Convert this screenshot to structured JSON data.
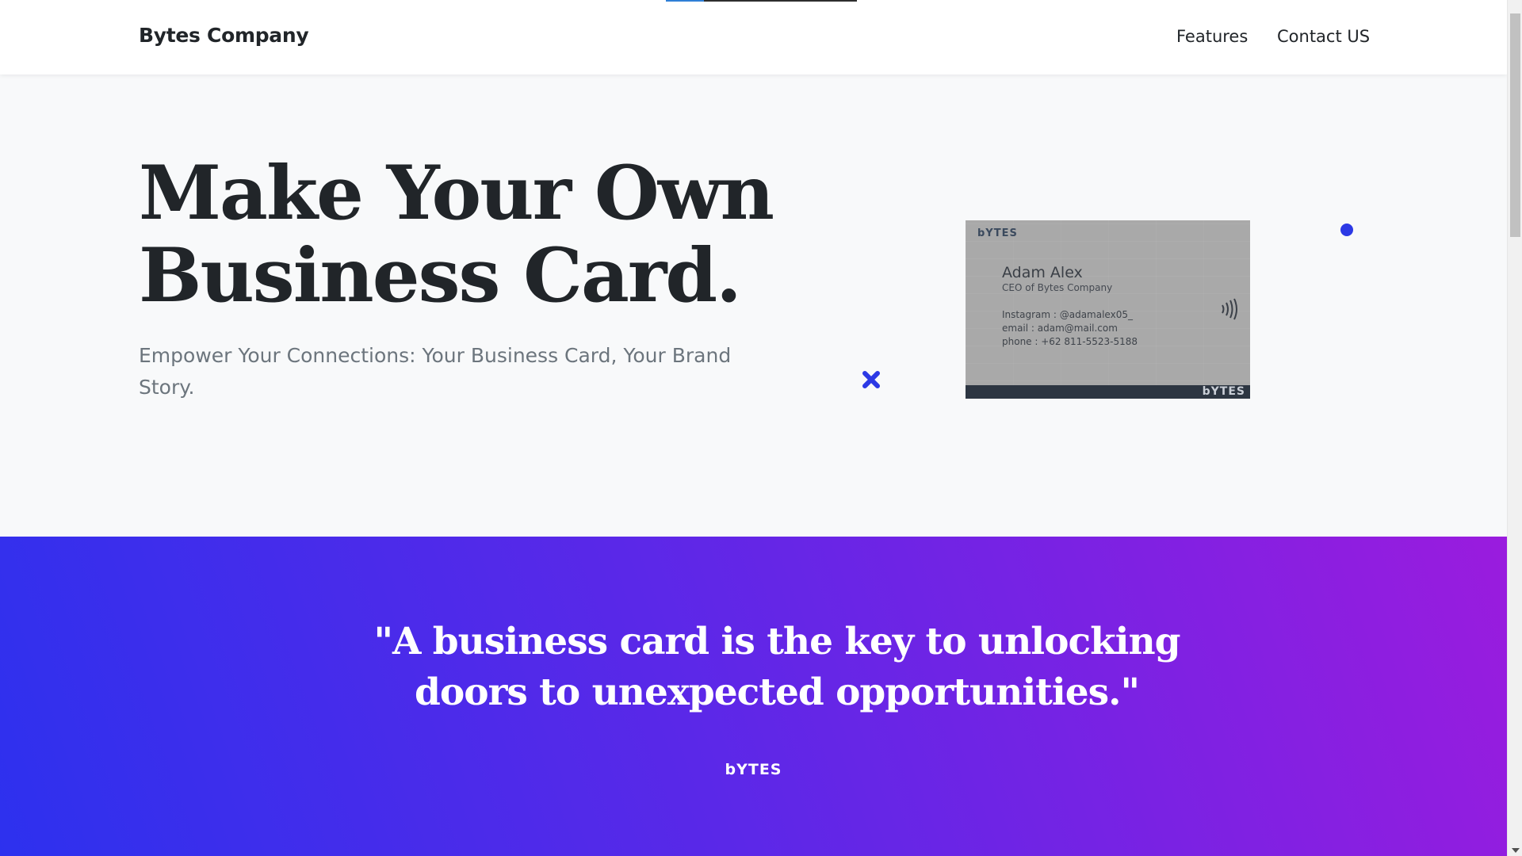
{
  "page_loader": {
    "progress": 0.2
  },
  "navbar": {
    "brand": "Bytes Company",
    "links": [
      {
        "label": "Features"
      },
      {
        "label": "Contact US"
      }
    ]
  },
  "hero": {
    "title_line1": "Make Your Own",
    "title_line2": "Business Card.",
    "subtitle": "Empower Your Connections: Your Business Card, Your Brand Story."
  },
  "card": {
    "logo_top": "bYTES",
    "name": "Adam Alex",
    "role": "CEO of Bytes Company",
    "instagram": "Instagram : @adamalex05_",
    "email": "email : adam@mail.com",
    "phone": "phone : +62 811-5523-5188",
    "logo_bottom": "bYTES",
    "icons": {
      "contactless": "nfc-icon"
    }
  },
  "decorations": {
    "accent_color": "#2c39e5",
    "shapes": [
      "x-mark-icon",
      "dot-icon"
    ]
  },
  "quote_section": {
    "quote_line1": "\"A business card is the key to unlocking",
    "quote_line2": "doors to unexpected opportunities.\"",
    "logo": "bYTES",
    "gradient_start": "#2d31ee",
    "gradient_end": "#9a1cde"
  }
}
